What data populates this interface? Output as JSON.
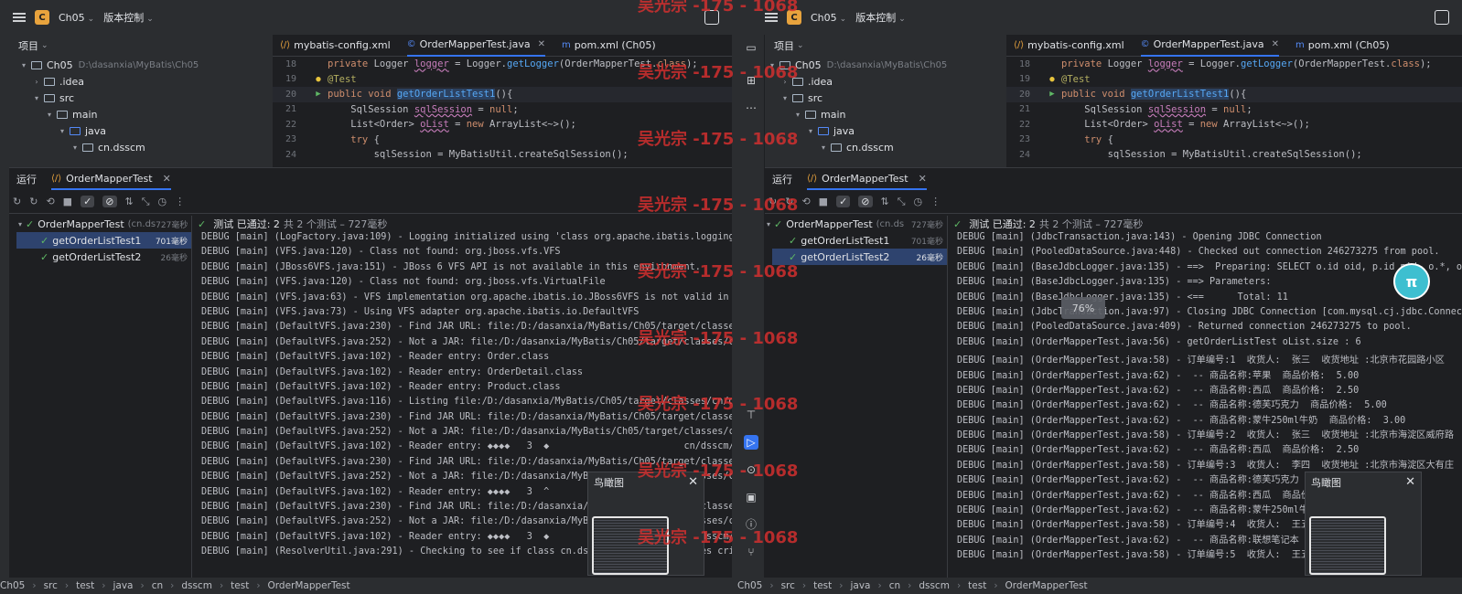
{
  "toolbar": {
    "project_badge": "C",
    "project_name": "Ch05",
    "vcs_label": "版本控制"
  },
  "project_tree": {
    "header": "项目",
    "rows": [
      {
        "label": "Ch05",
        "path": "D:\\dasanxia\\MyBatis\\Ch05"
      },
      {
        "label": ".idea"
      },
      {
        "label": "src"
      },
      {
        "label": "main"
      },
      {
        "label": "java"
      },
      {
        "label": "cn.dsscm"
      }
    ]
  },
  "editor": {
    "tabs": [
      "mybatis-config.xml",
      "OrderMapperTest.java",
      "pom.xml (Ch05)"
    ],
    "line_numbers": [
      "18",
      "19",
      "20",
      "21",
      "22",
      "23",
      "24"
    ]
  },
  "run_panel": {
    "title": "运行",
    "config_tab": "OrderMapperTest",
    "test_suite": "OrderMapperTest",
    "test_suite_pkg": "(cn.ds",
    "test_suite_time": "727毫秒",
    "tests": [
      {
        "name": "getOrderListTest1",
        "time": "701毫秒"
      },
      {
        "name": "getOrderListTest2",
        "time": "26毫秒"
      }
    ],
    "status_passed": "测试 已通过: 2",
    "status_rest": "共 2 个测试 – 727毫秒"
  },
  "console_left": [
    "DEBUG [main] (LogFactory.java:109) - Logging initialized using 'class org.apache.ibatis.logging",
    "DEBUG [main] (VFS.java:120) - Class not found: org.jboss.vfs.VFS",
    "DEBUG [main] (JBoss6VFS.java:151) - JBoss 6 VFS API is not available in this environment.",
    "DEBUG [main] (VFS.java:120) - Class not found: org.jboss.vfs.VirtualFile",
    "DEBUG [main] (VFS.java:63) - VFS implementation org.apache.ibatis.io.JBoss6VFS is not valid in",
    "DEBUG [main] (VFS.java:73) - Using VFS adapter org.apache.ibatis.io.DefaultVFS",
    "DEBUG [main] (DefaultVFS.java:230) - Find JAR URL: file:/D:/dasanxia/MyBatis/Ch05/target/classe",
    "DEBUG [main] (DefaultVFS.java:252) - Not a JAR: file:/D:/dasanxia/MyBatis/Ch05/target/classes/c",
    "DEBUG [main] (DefaultVFS.java:102) - Reader entry: Order.class",
    "DEBUG [main] (DefaultVFS.java:102) - Reader entry: OrderDetail.class",
    "DEBUG [main] (DefaultVFS.java:102) - Reader entry: Product.class",
    "DEBUG [main] (DefaultVFS.java:116) - Listing file:/D:/dasanxia/MyBatis/Ch05/target/classes/cn/d",
    "DEBUG [main] (DefaultVFS.java:230) - Find JAR URL: file:/D:/dasanxia/MyBatis/Ch05/target/classe",
    "DEBUG [main] (DefaultVFS.java:252) - Not a JAR: file:/D:/dasanxia/MyBatis/Ch05/target/classes/c",
    "DEBUG [main] (DefaultVFS.java:102) - Reader entry: ◆◆◆◆   3  ◆                        cn/dsscm/pojo/Or",
    "DEBUG [main] (DefaultVFS.java:230) - Find JAR URL: file:/D:/dasanxia/MyBatis/Ch05/target/classe",
    "DEBUG [main] (DefaultVFS.java:252) - Not a JAR: file:/D:/dasanxia/MyBatis/Ch05/target/classes/c",
    "DEBUG [main] (DefaultVFS.java:102) - Reader entry: ◆◆◆◆   3  ^",
    "DEBUG [main] (DefaultVFS.java:230) - Find JAR URL: file:/D:/dasanxia/MyBatis/Ch05/target/classe",
    "DEBUG [main] (DefaultVFS.java:252) - Not a JAR: file:/D:/dasanxia/MyBatis/Ch05/target/classes/c",
    "DEBUG [main] (DefaultVFS.java:102) - Reader entry: ◆◆◆◆   3  ◆                        cn/dsscm/pojo/Pr",
    "DEBUG [main] (ResolverUtil.java:291) - Checking to see if class cn.dsscm.pojo.Order matches cri"
  ],
  "console_right": [
    "DEBUG [main] (JdbcTransaction.java:143) - Opening JDBC Connection",
    "DEBUG [main] (PooledDataSource.java:448) - Checked out connection 246273275 from pool.",
    "DEBUG [main] (BaseJdbcLogger.java:135) - ==>  Preparing: SELECT o.id oid, p.id pid, o.*, od",
    "DEBUG [main] (BaseJdbcLogger.java:135) - ==> Parameters: ",
    "DEBUG [main] (BaseJdbcLogger.java:135) - <==      Total: 11",
    "DEBUG [main] (JdbcTransaction.java:97) - Closing JDBC Connection [com.mysql.cj.jdbc.Connect",
    "DEBUG [main] (PooledDataSource.java:409) - Returned connection 246273275 to pool.",
    "DEBUG [main] (OrderMapperTest.java:56) - getOrderListTest oList.size : 6",
    "DEBUG [main] (OrderMapperTest.java:58) - 订单编号:1  收货人:  张三  收货地址 :北京市花园路小区",
    "DEBUG [main] (OrderMapperTest.java:62) -  -- 商品名称:苹果  商品价格:  5.00",
    "DEBUG [main] (OrderMapperTest.java:62) -  -- 商品名称:西瓜  商品价格:  2.50",
    "DEBUG [main] (OrderMapperTest.java:62) -  -- 商品名称:德芙巧克力  商品价格:  5.00",
    "DEBUG [main] (OrderMapperTest.java:62) -  -- 商品名称:蒙牛250ml牛奶  商品价格:  3.00",
    "DEBUG [main] (OrderMapperTest.java:58) - 订单编号:2  收货人:  张三  收货地址 :北京市海淀区威府路",
    "DEBUG [main] (OrderMapperTest.java:62) -  -- 商品名称:西瓜  商品价格:  2.50",
    "DEBUG [main] (OrderMapperTest.java:58) - 订单编号:3  收货人:  李四  收货地址 :北京市海淀区大有庄",
    "DEBUG [main] (OrderMapperTest.java:62) -  -- 商品名称:德芙巧克力  商品价格:  5.00",
    "DEBUG [main] (OrderMapperTest.java:62) -  -- 商品名称:西瓜  商品价格:  2.50",
    "DEBUG [main] (OrderMapperTest.java:62) -  -- 商品名称:蒙牛250ml牛奶  商品价格:  3.00",
    "DEBUG [main] (OrderMapperTest.java:58) - 订单编号:4  收货人:  王五  收货地址 :北京市",
    "DEBUG [main] (OrderMapperTest.java:62) -  -- 商品名称:联想笔记本  商品价格:",
    "DEBUG [main] (OrderMapperTest.java:58) - 订单编号:5  收货人:  王五  收货地址"
  ],
  "breadcrumb": [
    "Ch05",
    "src",
    "test",
    "java",
    "cn",
    "dsscm",
    "test",
    "OrderMapperTest"
  ],
  "birdseye": {
    "title": "鸟瞰图"
  },
  "coverage_badge": "76%",
  "watermark": "吴光宗 -175 - 1068",
  "colors": {
    "accent": "#3574f0",
    "pass": "#5fb865",
    "watermark": "#d8302f"
  }
}
